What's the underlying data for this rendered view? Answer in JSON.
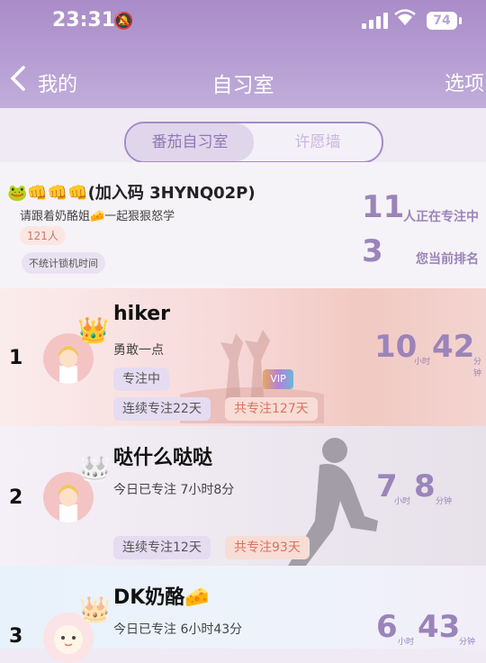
{
  "status_bar": {
    "time": "23:31",
    "battery": "74"
  },
  "nav": {
    "back_label": "我的",
    "title": "自习室",
    "options_label": "选项"
  },
  "tabs": [
    {
      "label": "番茄自习室",
      "active": true
    },
    {
      "label": "许愿墙",
      "active": false
    }
  ],
  "room": {
    "name": "🐸👊👊👊(加入码 3HYNQ02P)",
    "description": "请跟着奶酪姐🧀一起狠狠怒学",
    "member_count": "121人",
    "lock_note": "不统计锁机时间",
    "focusing_count": "11",
    "focusing_label": "人正在专注中",
    "rank_value": "3",
    "rank_label": "您当前排名"
  },
  "leaderboard": [
    {
      "rank": "1",
      "name": "hiker",
      "subtitle": "勇敢一点",
      "status": "专注中",
      "vip": "VIP",
      "streak": "连续专注22天",
      "total": "共专注127天",
      "hours": "10",
      "hour_unit": "小时",
      "minutes": "42",
      "minute_unit": "分钟"
    },
    {
      "rank": "2",
      "name": "哒什么哒哒",
      "subtitle": "今日已专注 7小时8分",
      "streak": "连续专注12天",
      "total": "共专注93天",
      "hours": "7",
      "hour_unit": "小时",
      "minutes": "8",
      "minute_unit": "分钟"
    },
    {
      "rank": "3",
      "name": "DK奶酪🧀",
      "subtitle": "今日已专注 6小时43分",
      "hours": "6",
      "hour_unit": "小时",
      "minutes": "43",
      "minute_unit": "分钟"
    }
  ],
  "colors": {
    "accent": "#9b84b9",
    "header": "#b79fd3",
    "orange_text": "#d9735c"
  }
}
